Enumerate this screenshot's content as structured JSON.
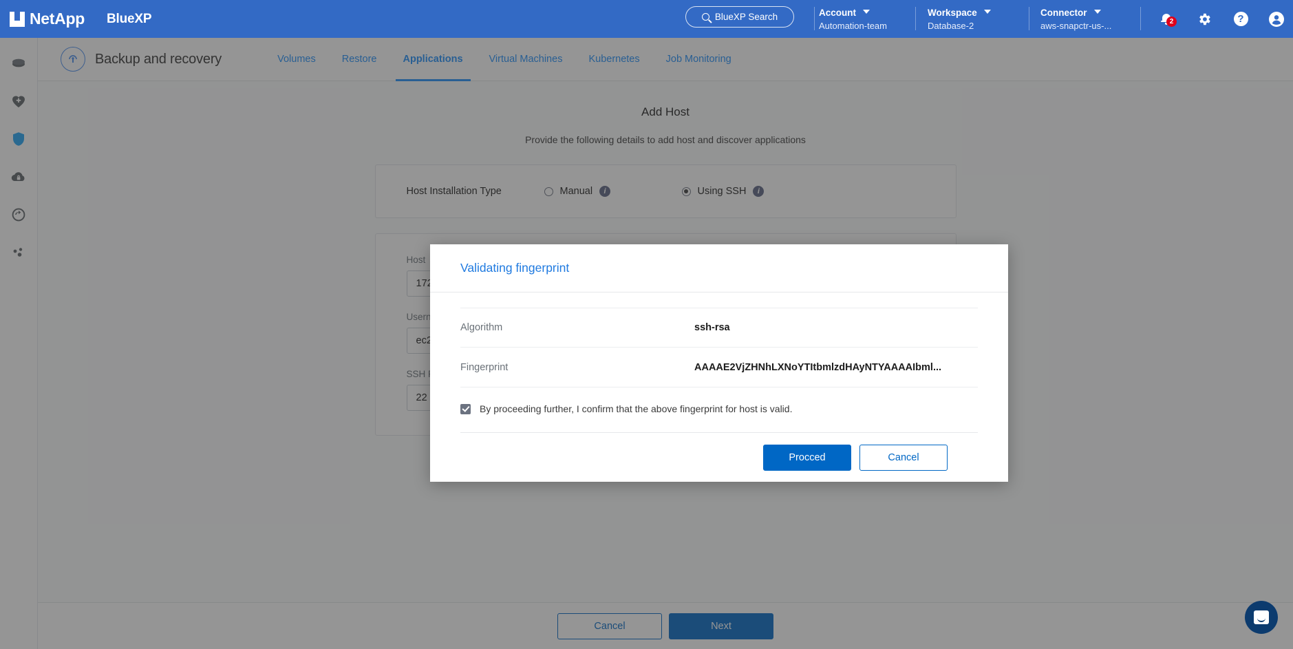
{
  "topbar": {
    "brand": "NetApp",
    "product": "BlueXP",
    "search_label": "BlueXP Search",
    "groups": [
      {
        "title": "Account",
        "value": "Automation-team"
      },
      {
        "title": "Workspace",
        "value": "Database-2"
      },
      {
        "title": "Connector",
        "value": "aws-snapctr-us-..."
      }
    ],
    "notification_count": "2",
    "help_glyph": "?",
    "accent": "#336ac5"
  },
  "rail": {
    "items": [
      {
        "name": "storage-icon",
        "active": false
      },
      {
        "name": "health-icon",
        "active": false
      },
      {
        "name": "protection-icon",
        "active": true
      },
      {
        "name": "governance-icon",
        "active": false
      },
      {
        "name": "mobility-icon",
        "active": false
      },
      {
        "name": "extensions-icon",
        "active": false
      }
    ]
  },
  "subnav": {
    "service_title": "Backup and recovery",
    "tabs": [
      {
        "label": "Volumes",
        "active": false
      },
      {
        "label": "Restore",
        "active": false
      },
      {
        "label": "Applications",
        "active": true
      },
      {
        "label": "Virtual Machines",
        "active": false
      },
      {
        "label": "Kubernetes",
        "active": false
      },
      {
        "label": "Job Monitoring",
        "active": false
      }
    ],
    "accent": "#1f8efa"
  },
  "page": {
    "title": "Add Host",
    "subtitle": "Provide the following details to add host and discover applications",
    "install_type": {
      "label": "Host Installation Type",
      "options": [
        {
          "label": "Manual",
          "selected": false
        },
        {
          "label": "Using SSH",
          "selected": true
        }
      ],
      "info_glyph": "i"
    },
    "fields": [
      {
        "label": "Host",
        "value": "172"
      },
      {
        "label": "Username",
        "value": "ec2"
      },
      {
        "label": "SSH Port",
        "value": "22"
      }
    ]
  },
  "footer": {
    "cancel_label": "Cancel",
    "next_label": "Next"
  },
  "modal": {
    "title": "Validating fingerprint",
    "rows": [
      {
        "key": "Algorithm",
        "value": "ssh-rsa"
      },
      {
        "key": "Fingerprint",
        "value": "AAAAE2VjZHNhLXNoYTItbmlzdHAyNTYAAAAIbml..."
      }
    ],
    "consent_text": "By proceeding further, I confirm that the above fingerprint for host is valid.",
    "consent_checked": true,
    "proceed_label": "Procced",
    "cancel_label": "Cancel",
    "accent": "#0067c5"
  },
  "chat": {
    "name": "chat-bubble"
  }
}
